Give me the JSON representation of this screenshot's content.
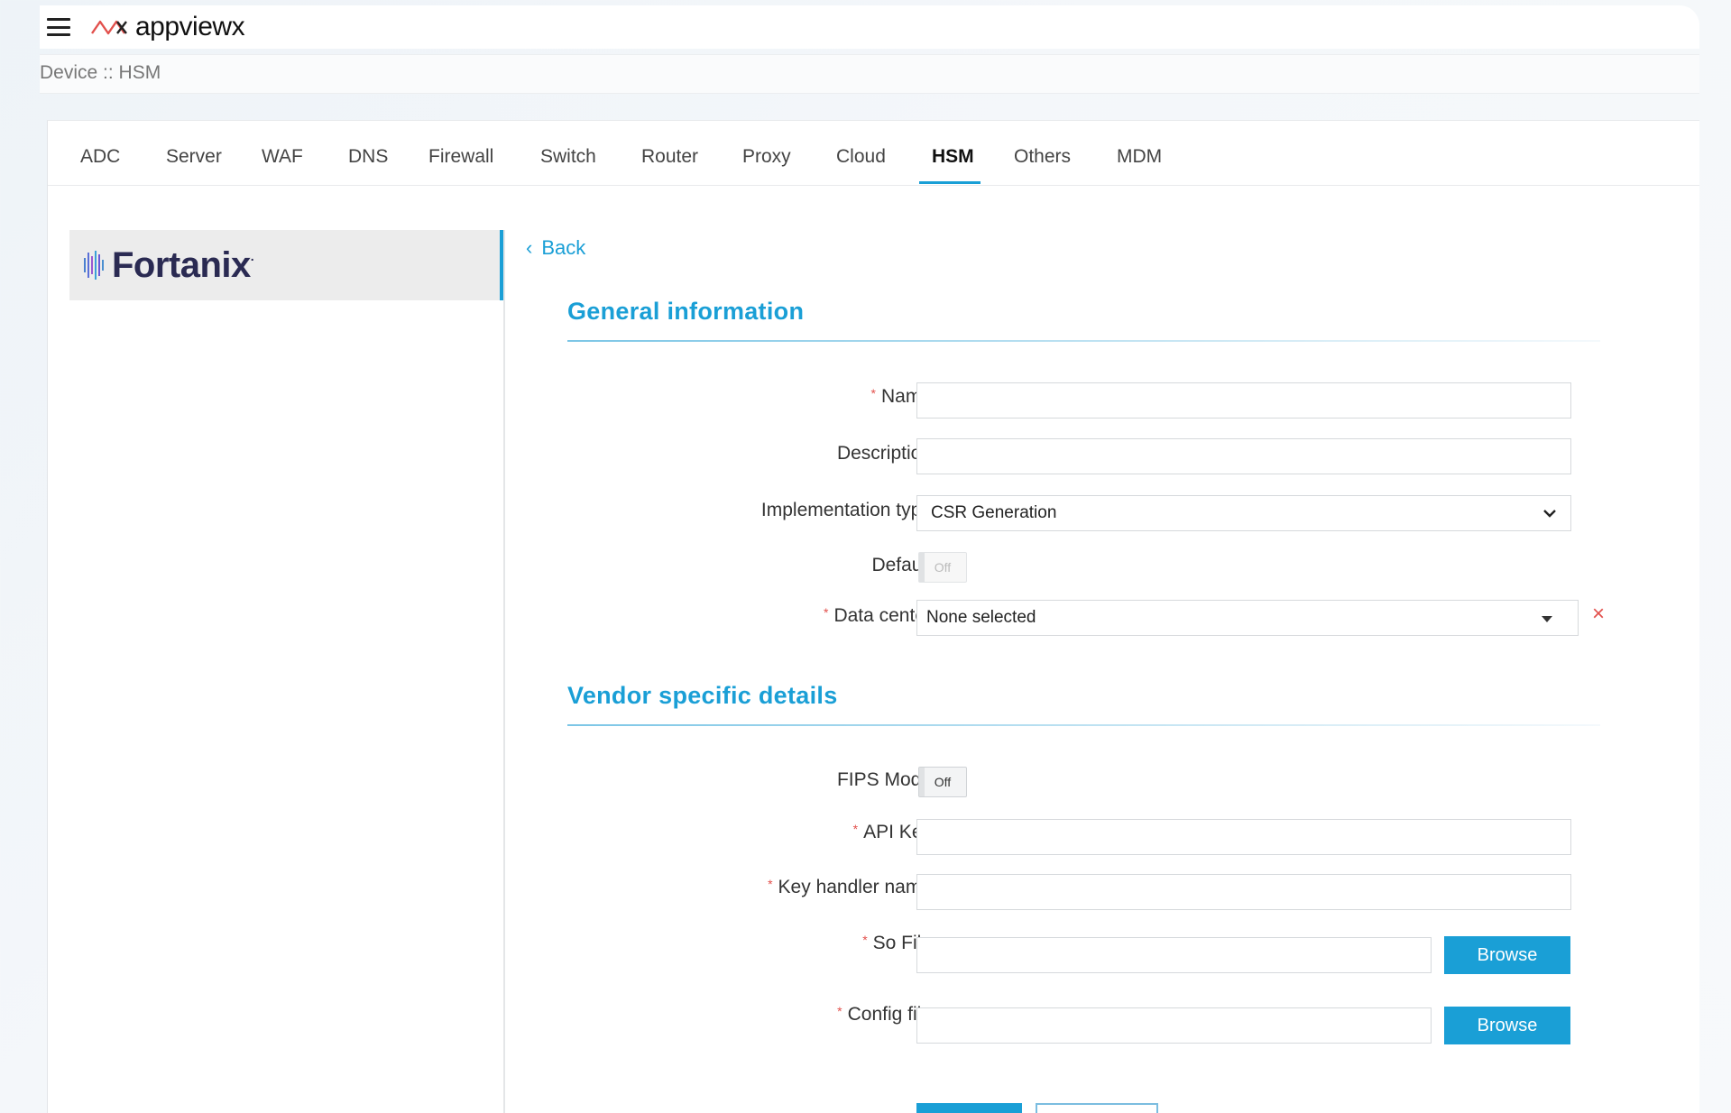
{
  "app": {
    "brand_name": "appviewx"
  },
  "breadcrumb": "Device :: HSM",
  "tabs": [
    {
      "label": "ADC"
    },
    {
      "label": "Server"
    },
    {
      "label": "WAF"
    },
    {
      "label": "DNS"
    },
    {
      "label": "Firewall"
    },
    {
      "label": "Switch"
    },
    {
      "label": "Router"
    },
    {
      "label": "Proxy"
    },
    {
      "label": "Cloud"
    },
    {
      "label": "HSM",
      "active": true
    },
    {
      "label": "Others"
    },
    {
      "label": "MDM"
    }
  ],
  "vendor": {
    "name": "Fortanix"
  },
  "back_label": "Back",
  "general": {
    "title": "General information",
    "name_label": "Name",
    "name_value": "",
    "description_label": "Description",
    "description_value": "",
    "implementation_label": "Implementation type",
    "implementation_value": "CSR Generation",
    "default_label": "Default",
    "default_toggle": "Off",
    "datacenter_label": "Data center",
    "datacenter_value": "None selected",
    "clear_symbol": "×"
  },
  "vendor_details": {
    "title": "Vendor specific details",
    "fips_label": "FIPS Mode",
    "fips_toggle": "Off",
    "api_key_label": "API Key",
    "key_handler_label": "Key handler name",
    "so_file_label": "So File",
    "config_file_label": "Config file",
    "browse_label": "Browse"
  },
  "colors": {
    "accent": "#1a9fd6",
    "required": "#e2504c",
    "vendor_name": "#2a2a52"
  }
}
